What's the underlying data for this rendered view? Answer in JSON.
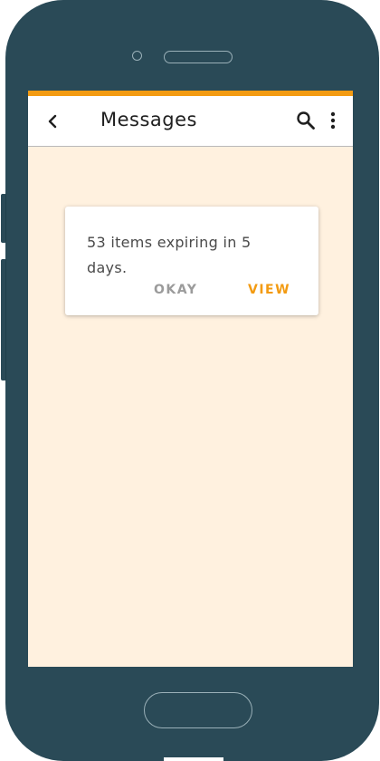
{
  "app_bar": {
    "title": "Messages",
    "back_icon": "chevron-left-icon",
    "search_icon": "search-icon",
    "more_icon": "more-vertical-icon"
  },
  "dialog": {
    "message": "53 items expiring in 5 days.",
    "dismiss_label": "OKAY",
    "confirm_label": "VIEW"
  },
  "colors": {
    "accent": "#f39b12",
    "screen_background": "#fff1df",
    "device_body": "#2a4a57",
    "dismiss_text": "#9b9b9b"
  }
}
